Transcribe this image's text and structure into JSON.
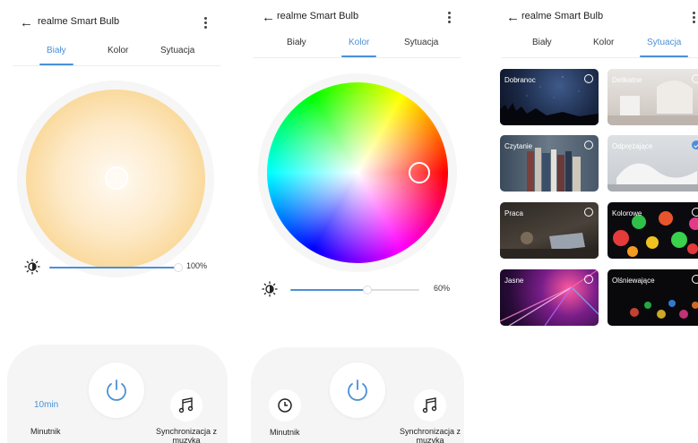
{
  "app": {
    "title": "realme Smart Bulb",
    "back_glyph": "←"
  },
  "tabs": [
    "Biały",
    "Kolor",
    "Sytuacja"
  ],
  "white_screen": {
    "active_tab": "Biały",
    "brightness_pct": 100,
    "brightness_label": "100%",
    "timer_value": "10min",
    "timer_label": "Minutnik",
    "sync_label_line1": "Synchronizacja z",
    "sync_label_line2": "muzyka"
  },
  "color_screen": {
    "active_tab": "Kolor",
    "brightness_pct": 60,
    "brightness_label": "60%",
    "timer_label": "Minutnik",
    "sync_label_line1": "Synchronizacja z",
    "sync_label_line2": "muzyka"
  },
  "scene_screen": {
    "active_tab": "Sytuacja",
    "scenes": [
      {
        "label": "Dobranoc",
        "checked": false
      },
      {
        "label": "Delikatne",
        "checked": false
      },
      {
        "label": "Czytanie",
        "checked": false
      },
      {
        "label": "Odprężające",
        "checked": true
      },
      {
        "label": "Praca",
        "checked": false
      },
      {
        "label": "Kolorowe",
        "checked": false
      },
      {
        "label": "Jasne",
        "checked": false
      },
      {
        "label": "Olśniewające",
        "checked": false
      }
    ]
  },
  "colors": {
    "accent": "#4a90d9",
    "warm_white_center": "#fffaf0",
    "warm_white_edge": "#f7c96c"
  },
  "icons": [
    "back-arrow-icon",
    "more-vertical-icon",
    "brightness-icon",
    "power-icon",
    "clock-icon",
    "music-note-icon",
    "radio-check-icon"
  ]
}
